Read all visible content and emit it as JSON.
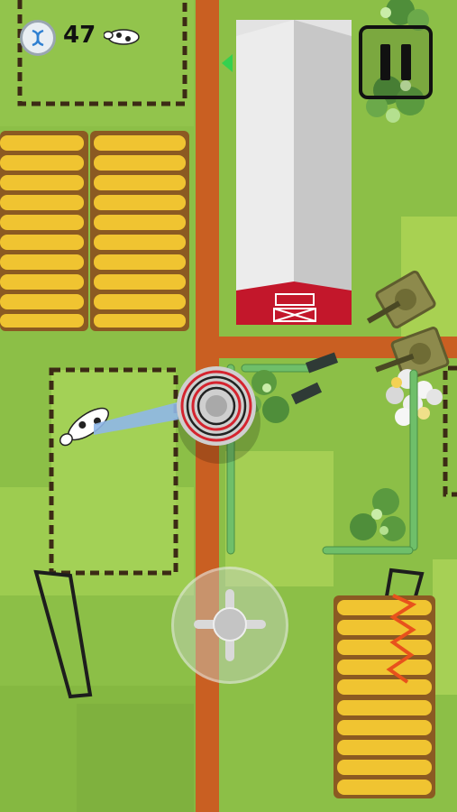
{
  "hud": {
    "score": "47",
    "dna_icon": "dna-icon",
    "cow_icon": "cow-icon",
    "pause_icon": "pause-icon",
    "joystick_icon": "joystick-icon"
  },
  "world": {
    "barn_sign": "barn-door-icon",
    "colors": {
      "grass": "#8cbf47",
      "road": "#c95f22",
      "hay": "#f0c431",
      "barn_red": "#c3172b",
      "tank": "#8d8a4c"
    }
  }
}
